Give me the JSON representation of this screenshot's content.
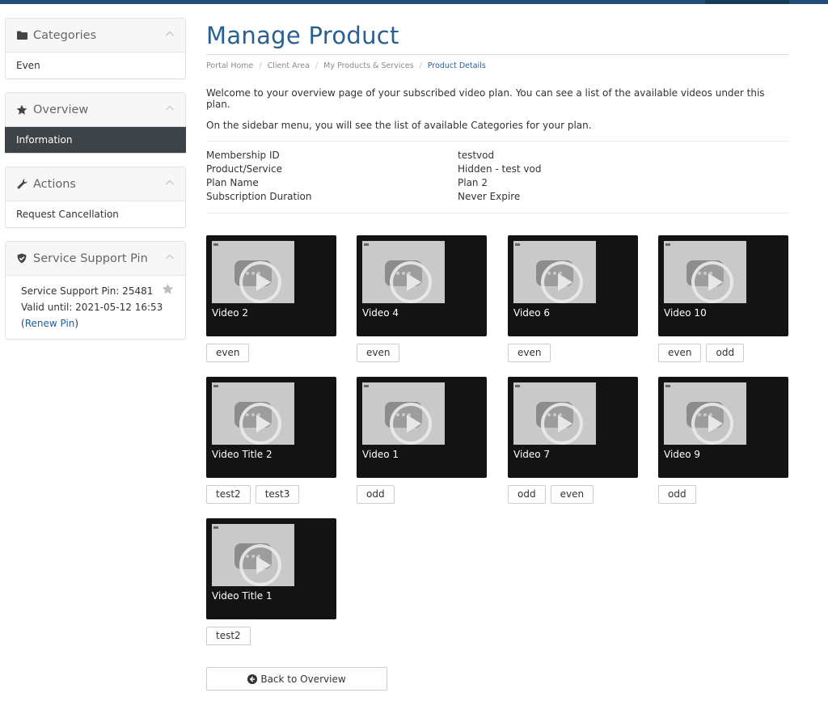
{
  "sidebar": {
    "categories": {
      "title": "Categories",
      "items": [
        "Even"
      ]
    },
    "overview": {
      "title": "Overview",
      "items": [
        "Information"
      ]
    },
    "actions": {
      "title": "Actions",
      "items": [
        "Request Cancellation"
      ]
    },
    "pin": {
      "title": "Service Support Pin",
      "pin_line": "Service Support Pin: 25481",
      "valid_line": "Valid until: 2021-05-12 16:53",
      "renew_label": "Renew Pin"
    }
  },
  "main": {
    "title": "Manage Product",
    "breadcrumb": [
      "Portal Home",
      "Client Area",
      "My Products & Services",
      "Product Details"
    ],
    "intro": [
      "Welcome to your overview page of your subscribed video plan. You can see a list of the available videos under this plan.",
      "On the sidebar menu, you will see the list of available Categories for your plan."
    ],
    "details": [
      {
        "label": "Membership ID",
        "value": "testvod"
      },
      {
        "label": "Product/Service",
        "value": "Hidden - test vod"
      },
      {
        "label": "Plan Name",
        "value": "Plan 2"
      },
      {
        "label": "Subscription Duration",
        "value": "Never Expire"
      }
    ],
    "videos": [
      {
        "title": "Video 2",
        "tags": [
          "even"
        ]
      },
      {
        "title": "Video 4",
        "tags": [
          "even"
        ]
      },
      {
        "title": "Video 6",
        "tags": [
          "even"
        ]
      },
      {
        "title": "Video 10",
        "tags": [
          "even",
          "odd"
        ]
      },
      {
        "title": "Video Title 2",
        "tags": [
          "test2",
          "test3"
        ]
      },
      {
        "title": "Video 1",
        "tags": [
          "odd"
        ]
      },
      {
        "title": "Video 7",
        "tags": [
          "odd",
          "even"
        ]
      },
      {
        "title": "Video 9",
        "tags": [
          "odd"
        ]
      },
      {
        "title": "Video Title 1",
        "tags": [
          "test2"
        ]
      }
    ],
    "back_label": "Back to Overview"
  },
  "colors": {
    "topbar": "#1e4e79",
    "title": "#2a5f8f",
    "active_item_bg": "#3d4347",
    "card_bg": "#131313",
    "link": "#1f5d9b"
  }
}
